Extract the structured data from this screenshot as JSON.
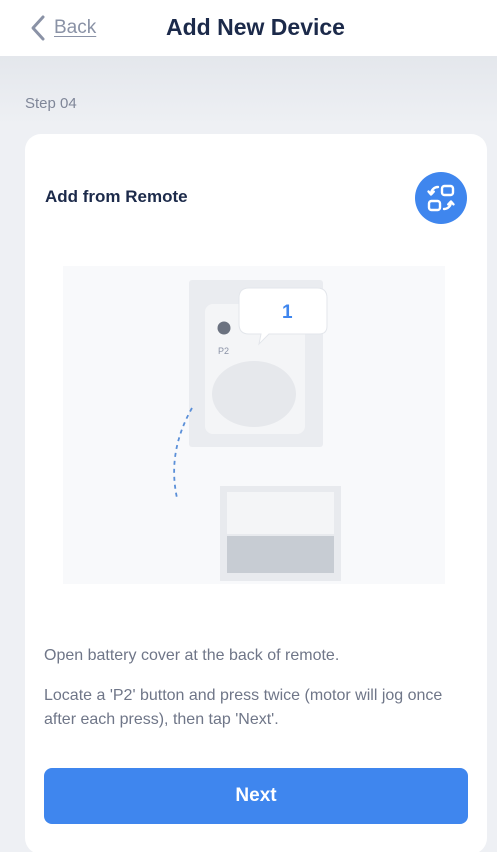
{
  "header": {
    "back_label": "Back",
    "title": "Add New Device"
  },
  "step": "Step 04",
  "card": {
    "title": "Add from Remote",
    "illustration": {
      "count": "1",
      "button_label": "P2"
    },
    "instruction_1": "Open battery cover at the back of remote.",
    "instruction_2": "Locate a 'P2' button and press twice (motor will jog once after each press), then tap 'Next'.",
    "next_label": "Next"
  },
  "icons": {
    "back": "chevron-left-icon",
    "switch": "switch-method-icon"
  },
  "colors": {
    "accent": "#3f86ee",
    "title_text": "#1c2a4a",
    "body_text": "#6f7688"
  }
}
